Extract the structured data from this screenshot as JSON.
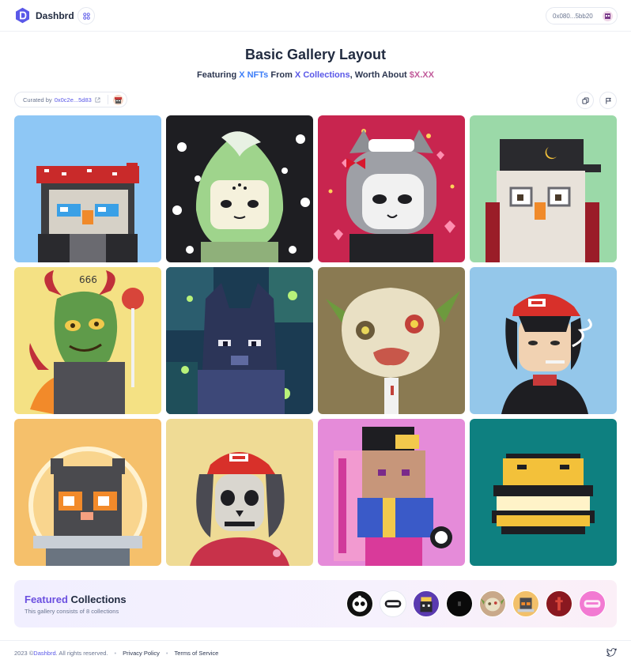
{
  "header": {
    "brand": "Dashbrd",
    "wallet_address": "0x080...5bb20"
  },
  "page": {
    "title": "Basic Gallery Layout",
    "subtitle": {
      "featuring": "Featuring ",
      "nfts": "X NFTs",
      "from": " From ",
      "collections": "X Collections",
      "worth": ", Worth About ",
      "value": "$X.XX"
    }
  },
  "curator": {
    "label": "Curated by",
    "address": "0x0c2e...5d83"
  },
  "gallery": {
    "tiles": [
      {
        "name": "pixel-owl-bandana",
        "bg": "#8ec7f5"
      },
      {
        "name": "green-creature-stars",
        "bg": "#1e1e22"
      },
      {
        "name": "cat-maid-hearts",
        "bg": "#c8254f"
      },
      {
        "name": "pixel-owl-cap",
        "bg": "#9bd9a8"
      },
      {
        "name": "zombie-demon",
        "bg": "#f4e184"
      },
      {
        "name": "pixel-wolf-forest",
        "bg": "#1b3b52"
      },
      {
        "name": "goblin-head",
        "bg": "#8a7a52"
      },
      {
        "name": "red-cap-boy",
        "bg": "#94c7ea"
      },
      {
        "name": "pixel-cat-astronaut",
        "bg": "#f5c06b"
      },
      {
        "name": "skeleton-cap",
        "bg": "#efdb95"
      },
      {
        "name": "pixel-pink-character",
        "bg": "#e58bd9"
      },
      {
        "name": "pixel-frog-burger",
        "bg": "#0e8080"
      }
    ]
  },
  "featured": {
    "title_accent": "Featured",
    "title_rest": " Collections",
    "subtitle": "This gallery consists of 8 collections",
    "collections": [
      {
        "name": "collection-1",
        "bg": "#111111"
      },
      {
        "name": "collection-2",
        "bg": "#ffffff"
      },
      {
        "name": "collection-3",
        "bg": "#5a3ab0"
      },
      {
        "name": "collection-4",
        "bg": "#0a0a0a"
      },
      {
        "name": "collection-5",
        "bg": "#c9a98a"
      },
      {
        "name": "collection-6",
        "bg": "#f2c06a"
      },
      {
        "name": "collection-7",
        "bg": "#8a1820"
      },
      {
        "name": "collection-8",
        "bg": "#f27ad2"
      }
    ]
  },
  "footer": {
    "copyright_prefix": "2023 © ",
    "brand": "Dashbrd",
    "copyright_suffix": ". All rights reserved.",
    "privacy": "Privacy Policy",
    "terms": "Terms of Service"
  }
}
